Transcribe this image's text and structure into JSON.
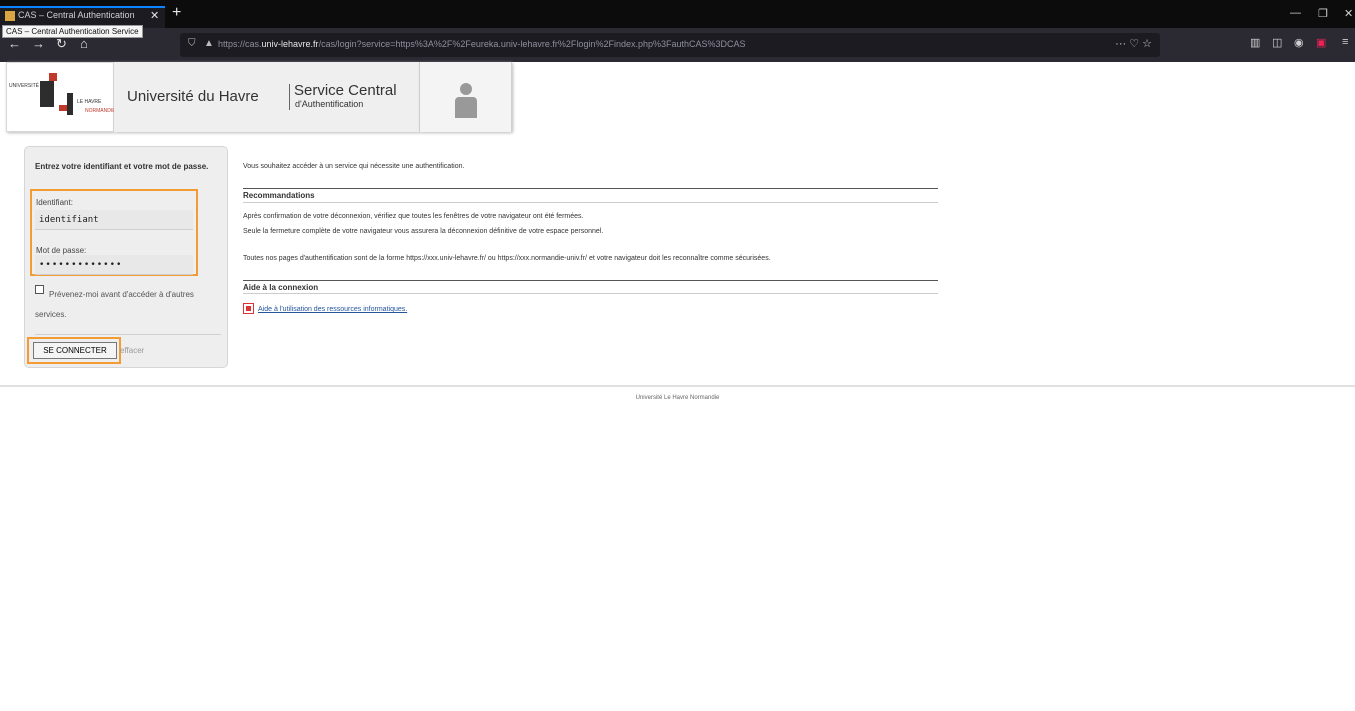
{
  "browser": {
    "tab_title": "CAS – Central Authentication",
    "tab_tooltip": "CAS – Central Authentication Service",
    "url_host_prefix": "https://cas.",
    "url_host_bold": "univ-lehavre.fr",
    "url_path": "/cas/login?service=https%3A%2F%2Feureka.univ-lehavre.fr%2Flogin%2Findex.php%3FauthCAS%3DCAS"
  },
  "header": {
    "logo_univ": "UNIVERSITÉ",
    "logo_havre": "LE HAVRE",
    "logo_normandie": "NORMANDIE",
    "university_name": "Université du Havre",
    "service_title": "Service Central",
    "service_subtitle": "d'Authentification"
  },
  "login": {
    "heading": "Entrez votre identifiant et votre mot de passe.",
    "username_label": "Identifiant:",
    "username_value": "identifiant",
    "password_label": "Mot de passe:",
    "password_value": "•••••••••••••",
    "warn_label": "Prévenez-moi avant d'accéder à d'autres services.",
    "submit_label": "SE CONNECTER",
    "reset_label": "effacer"
  },
  "content": {
    "intro": "Vous souhaitez accéder à un service qui nécessite une authentification.",
    "recommendations_title": "Recommandations",
    "rec_line1": "Après confirmation de votre déconnexion, vérifiez que toutes les fenêtres de votre navigateur ont été fermées.",
    "rec_line2": "Seule la fermeture complète de votre navigateur vous assurera la déconnexion définitive de votre espace personnel.",
    "rec_line3": "Toutes nos pages d'authentification sont de la forme https://xxx.univ-lehavre.fr/ ou https://xxx.normandie-univ.fr/ et votre navigateur doit les reconnaître comme sécurisées.",
    "help_title": "Aide à la connexion",
    "help_link": "Aide à l'utilisation des ressources informatiques."
  },
  "footer": {
    "text": "Université Le Havre Normandie"
  }
}
